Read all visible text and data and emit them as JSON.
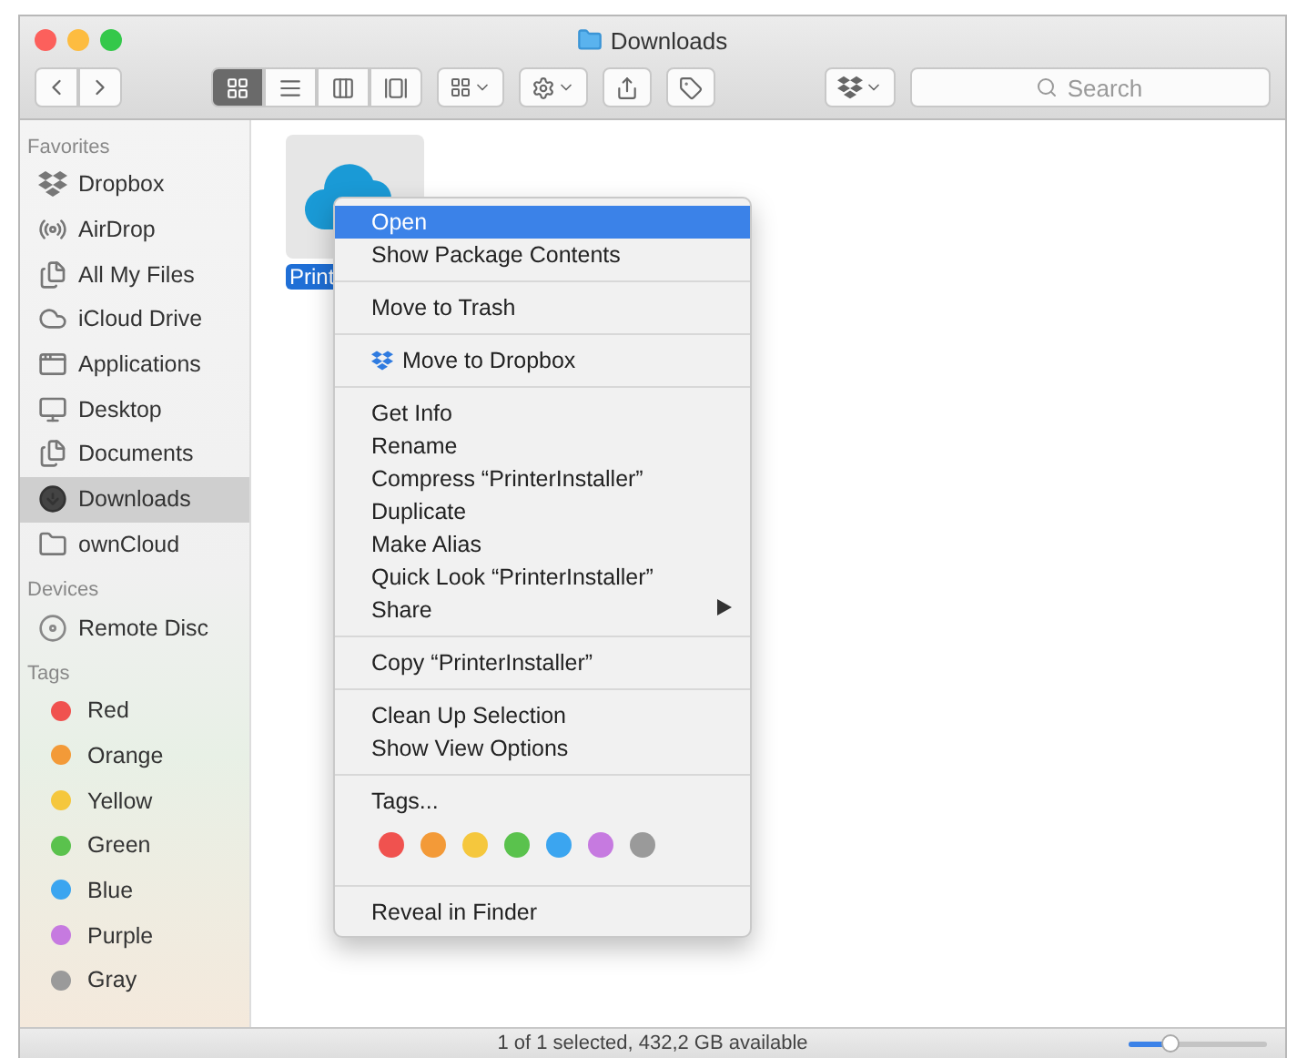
{
  "window": {
    "title": "Downloads"
  },
  "toolbar": {
    "view_modes": [
      {
        "selected": true
      },
      {
        "selected": false
      },
      {
        "selected": false
      },
      {
        "selected": false
      }
    ],
    "search": {
      "placeholder": "Search"
    }
  },
  "sidebar": {
    "sections": [
      {
        "heading": "Favorites",
        "items": [
          {
            "label": "Dropbox",
            "selected": false
          },
          {
            "label": "AirDrop",
            "selected": false
          },
          {
            "label": "All My Files",
            "selected": false
          },
          {
            "label": "iCloud Drive",
            "selected": false
          },
          {
            "label": "Applications",
            "selected": false
          },
          {
            "label": "Desktop",
            "selected": false
          },
          {
            "label": "Documents",
            "selected": false
          },
          {
            "label": "Downloads",
            "selected": true
          },
          {
            "label": "ownCloud",
            "selected": false
          }
        ]
      },
      {
        "heading": "Devices",
        "items": [
          {
            "label": "Remote Disc",
            "selected": false
          }
        ]
      },
      {
        "heading": "Tags",
        "items": [
          {
            "label": "Red",
            "selected": false,
            "color": "#f0524f"
          },
          {
            "label": "Orange",
            "selected": false,
            "color": "#f39a38"
          },
          {
            "label": "Yellow",
            "selected": false,
            "color": "#f5c73d"
          },
          {
            "label": "Green",
            "selected": false,
            "color": "#5ac24d"
          },
          {
            "label": "Blue",
            "selected": false,
            "color": "#3ba5f0"
          },
          {
            "label": "Purple",
            "selected": false,
            "color": "#c67ae0"
          },
          {
            "label": "Gray",
            "selected": false,
            "color": "#9a9a9a"
          }
        ]
      }
    ]
  },
  "files": [
    {
      "name": "Print",
      "selected": true
    }
  ],
  "context_menu": {
    "sections": [
      {
        "items": [
          {
            "kind": "text",
            "label": "Open",
            "selected": true
          },
          {
            "kind": "text",
            "label": "Show Package Contents",
            "selected": false
          }
        ]
      },
      {
        "items": [
          {
            "kind": "text",
            "label": "Move to Trash",
            "selected": false
          }
        ]
      },
      {
        "items": [
          {
            "kind": "icon",
            "label": "Move to Dropbox",
            "selected": false
          }
        ]
      },
      {
        "items": [
          {
            "kind": "text",
            "label": "Get Info",
            "selected": false
          },
          {
            "kind": "text",
            "label": "Rename",
            "selected": false
          },
          {
            "kind": "text",
            "label": "Compress “PrinterInstaller”",
            "selected": false
          },
          {
            "kind": "text",
            "label": "Duplicate",
            "selected": false
          },
          {
            "kind": "text",
            "label": "Make Alias",
            "selected": false
          },
          {
            "kind": "text",
            "label": "Quick Look “PrinterInstaller”",
            "selected": false
          },
          {
            "kind": "submenu",
            "label": "Share",
            "selected": false
          }
        ]
      },
      {
        "items": [
          {
            "kind": "text",
            "label": "Copy “PrinterInstaller”",
            "selected": false
          }
        ]
      },
      {
        "items": [
          {
            "kind": "text",
            "label": "Clean Up Selection",
            "selected": false
          },
          {
            "kind": "text",
            "label": "Show View Options",
            "selected": false
          }
        ]
      },
      {
        "items": [
          {
            "kind": "text",
            "label": "Tags...",
            "selected": false
          },
          {
            "kind": "colors",
            "colors": [
              {
                "color": "#f0524f"
              },
              {
                "color": "#f39a38"
              },
              {
                "color": "#f5c73d"
              },
              {
                "color": "#5ac24d"
              },
              {
                "color": "#3ba5f0"
              },
              {
                "color": "#c67ae0"
              },
              {
                "color": "#9a9a9a"
              }
            ]
          }
        ]
      },
      {
        "items": [
          {
            "kind": "text",
            "label": "Reveal in Finder",
            "selected": false
          }
        ]
      }
    ]
  },
  "status_bar": {
    "text": "1 of 1 selected, 432,2 GB available",
    "zoom": {
      "level": 0.3
    }
  }
}
